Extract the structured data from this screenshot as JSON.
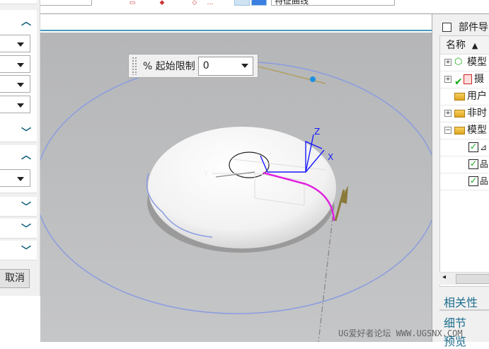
{
  "toolbar": {
    "feature_curve_field": "特征曲线"
  },
  "limit_bar": {
    "label": "% 起始限制",
    "value": "0"
  },
  "left_panel": {
    "cancel_label": "取消"
  },
  "part_navigator": {
    "title": "部件导",
    "column_name": "名称",
    "sort_icon": "▲",
    "items": [
      {
        "label": "模型",
        "expand": "+",
        "icon": "model-views-icon"
      },
      {
        "label": "摄",
        "expand": "+",
        "icon": "camera-icon"
      },
      {
        "label": "用户",
        "expand": "",
        "icon": "folder-icon"
      },
      {
        "label": "非时",
        "expand": "+",
        "icon": "folder-icon"
      },
      {
        "label": "模型",
        "expand": "−",
        "icon": "folder-icon"
      },
      {
        "label": "",
        "expand": "",
        "icon": "datum-csys-icon"
      },
      {
        "label": "",
        "expand": "",
        "icon": "sketch-icon"
      },
      {
        "label": "",
        "expand": "",
        "icon": "sketch-icon"
      }
    ],
    "sections": [
      "相关性",
      "细节",
      "预览"
    ]
  },
  "axes": {
    "x": "X",
    "y": "Y",
    "z": "Z"
  },
  "watermark": "UG爱好者论坛 WWW.UGSNX.COM",
  "colors": {
    "accent": "#0f5f7a",
    "path": "#e020e0",
    "axis": "#1a1aff"
  }
}
